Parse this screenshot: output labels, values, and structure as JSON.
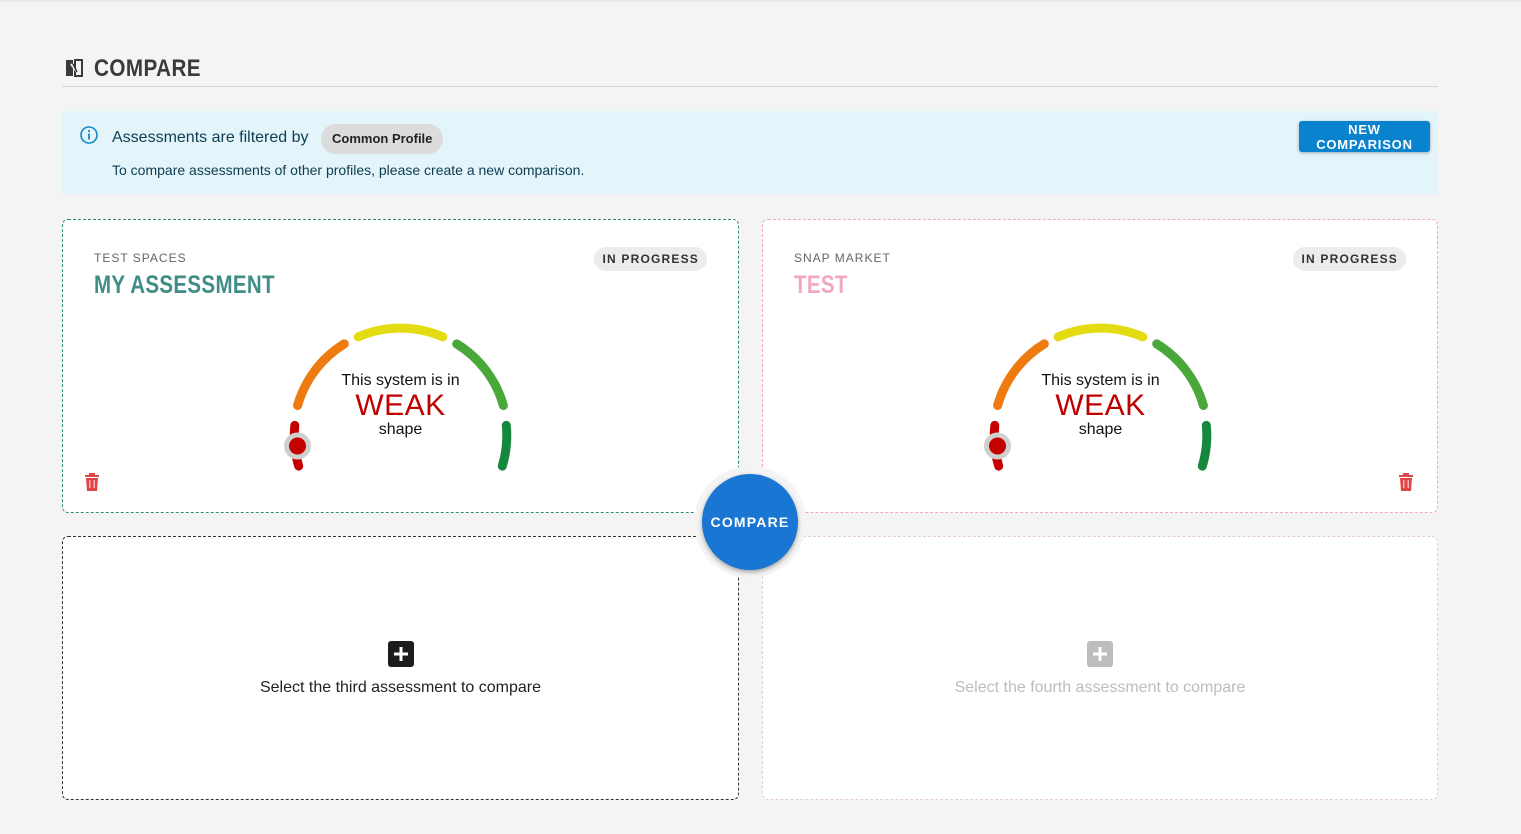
{
  "header": {
    "title": "COMPARE",
    "icon": "compare-icon"
  },
  "banner": {
    "title": "Assessments are filtered by",
    "filter_chip": "Common Profile",
    "subtitle": "To compare assessments of other profiles, please create a new comparison.",
    "new_comparison_label": "NEW COMPARISON",
    "icon": "info-icon"
  },
  "cards": [
    {
      "workspace": "TEST SPACES",
      "name": "MY ASSESSMENT",
      "status": "IN PROGRESS",
      "gauge": {
        "pre": "This system is in",
        "value": "WEAK",
        "post": "shape"
      },
      "accent_color": "#3f8d86"
    },
    {
      "workspace": "SNAP MARKET",
      "name": "TEST",
      "status": "IN PROGRESS",
      "gauge": {
        "pre": "This system is in",
        "value": "WEAK",
        "post": "shape"
      },
      "accent_color": "#f4a7c3"
    }
  ],
  "slots": {
    "third": "Select the third assessment to compare",
    "fourth": "Select the fourth assessment to compare"
  },
  "compare_label": "COMPARE",
  "colors": {
    "primary": "#1976d2",
    "new_button": "#0a83cf",
    "banner_bg": "#e3f4fb",
    "gauge_weak": "#c40000",
    "gauge_orange": "#ee7a10",
    "gauge_yellow": "#e4dc12",
    "gauge_green": "#4aa83b",
    "gauge_darkgreen": "#15883d",
    "trash": "#e04545"
  }
}
